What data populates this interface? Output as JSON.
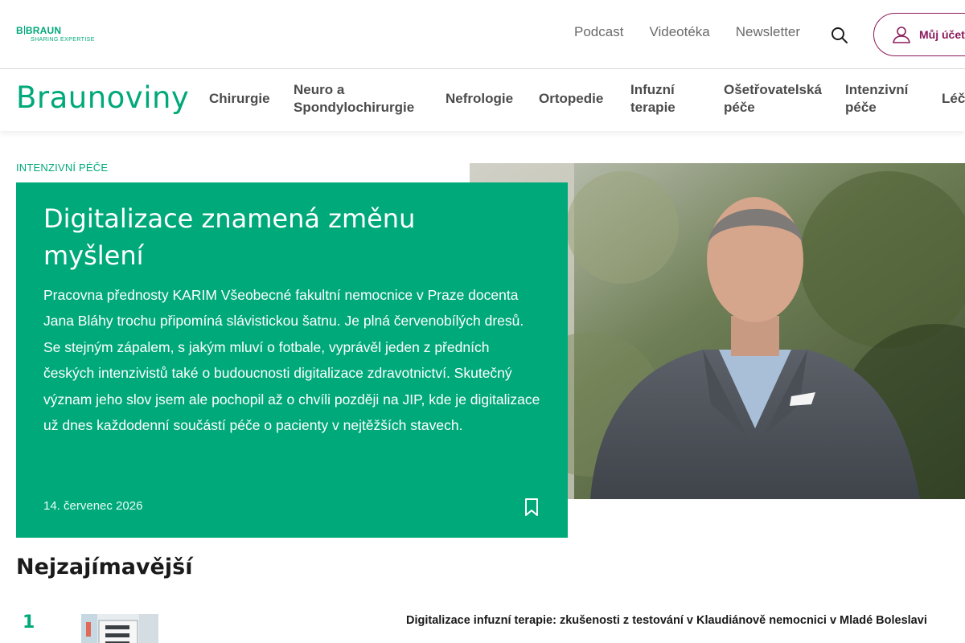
{
  "brand": {
    "logo_line1_left": "B",
    "logo_line1_right": "BRAUN",
    "logo_line2": "SHARING EXPERTISE",
    "site_name": "Braunoviny",
    "accent_color": "#00a97a",
    "account_color": "#8b1a5a"
  },
  "top_links": [
    "Podcast",
    "Videotéka",
    "Newsletter"
  ],
  "search": {
    "icon": "search-icon"
  },
  "account": {
    "label": "Můj účet",
    "icon": "user-icon"
  },
  "nav": {
    "chirurgie": "Chirurgie",
    "neuro_1": "Neuro a",
    "neuro_2": "Spondylochirurgie",
    "nefrologie": "Nefrologie",
    "ortopedie": "Ortopedie",
    "infuzni_1": "Infuzní",
    "infuzni_2": "terapie",
    "oset_1": "Ošetřovatelská",
    "oset_2": "péče",
    "intenz_1": "Intenzivní",
    "intenz_2": "péče",
    "leci": "Léči"
  },
  "hero": {
    "category": "INTENZIVNÍ PÉČE",
    "title": "Digitalizace znamená změnu myšlení",
    "text": "Pracovna přednosty KARIM Všeobecné fakultní nemocnice v Praze docenta Jana Bláhy trochu připomíná slávistickou šatnu. Je plná červenobílých dresů. Se stejným zápalem, s jakým mluví o fotbale, vyprávěl jeden z předních českých intenzivistů také o budoucnosti digitalizace zdravotnictví. Skutečný význam jeho slov jsem ale pochopil až o chvíli později na JIP, kde je digitalizace už dnes každodenní součástí péče o pacienty v nejtěžších stavech.",
    "date": "14. červenec 2026",
    "bookmark_icon": "bookmark-icon"
  },
  "most_interesting": {
    "title": "Nejzajímavější",
    "items": [
      {
        "rank": "1",
        "title": "Digitalizace infuzní terapie: zkušenosti z testování v Klaudiánově nemocnici v Mladé Boleslavi"
      }
    ]
  }
}
